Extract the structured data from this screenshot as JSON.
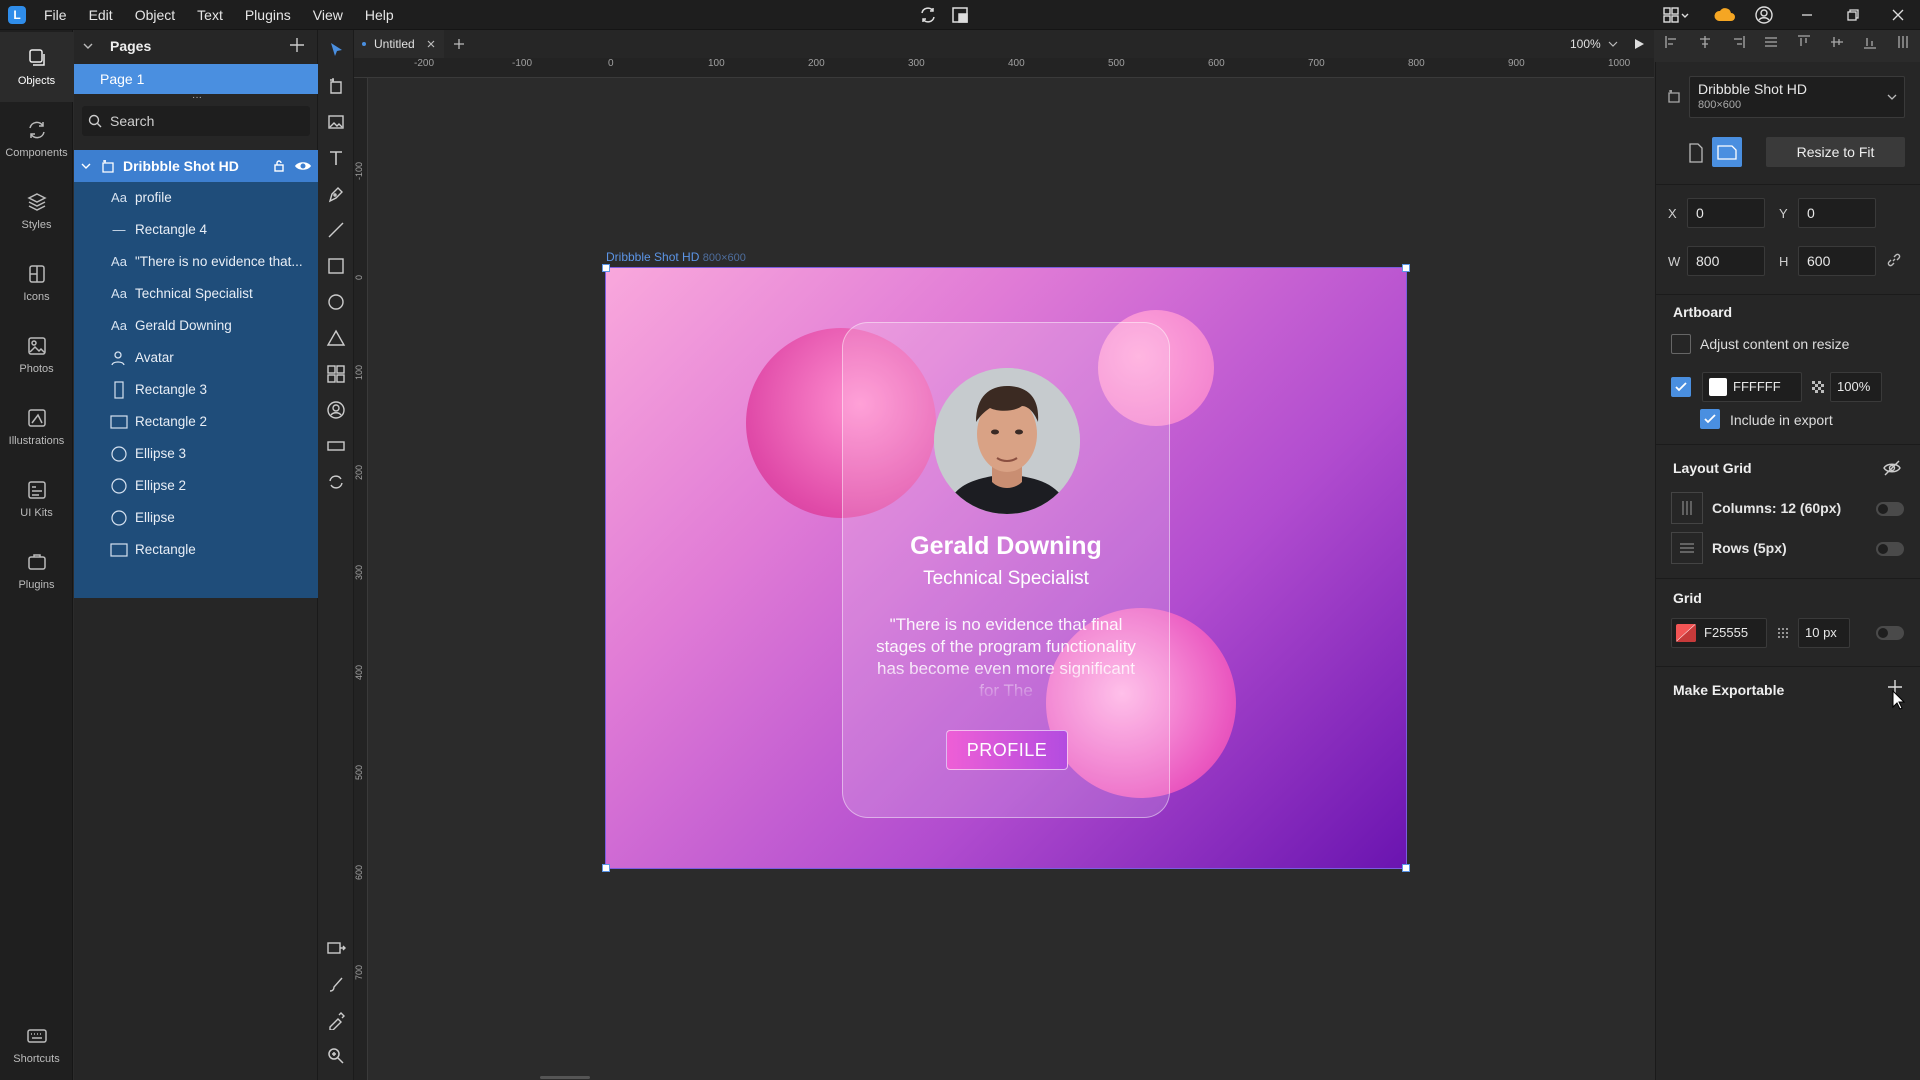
{
  "menu": [
    "File",
    "Edit",
    "Object",
    "Text",
    "Plugins",
    "View",
    "Help"
  ],
  "rail": [
    {
      "label": "Objects",
      "icon": "objects-icon"
    },
    {
      "label": "Components",
      "icon": "components-icon"
    },
    {
      "label": "Styles",
      "icon": "styles-icon"
    },
    {
      "label": "Icons",
      "icon": "icons-icon"
    },
    {
      "label": "Photos",
      "icon": "photos-icon"
    },
    {
      "label": "Illustrations",
      "icon": "illustrations-icon"
    },
    {
      "label": "UI Kits",
      "icon": "ui-kits-icon"
    },
    {
      "label": "Plugins",
      "icon": "plugins-icon"
    }
  ],
  "rail_bottom": "Shortcuts",
  "pages": {
    "title": "Pages",
    "current": "Page 1"
  },
  "search": {
    "placeholder": "Search"
  },
  "layers": {
    "root": "Dribbble Shot HD",
    "items": [
      {
        "icon": "Aa",
        "label": "profile"
      },
      {
        "icon": "—",
        "label": "Rectangle 4"
      },
      {
        "icon": "Aa",
        "label": "\"There is no evidence that..."
      },
      {
        "icon": "Aa",
        "label": "Technical Specialist"
      },
      {
        "icon": "Aa",
        "label": "Gerald Downing"
      },
      {
        "icon": "user",
        "label": "Avatar"
      },
      {
        "icon": "rect-tall",
        "label": "Rectangle 3"
      },
      {
        "icon": "rect",
        "label": "Rectangle 2"
      },
      {
        "icon": "circle",
        "label": "Ellipse 3"
      },
      {
        "icon": "circle",
        "label": "Ellipse 2"
      },
      {
        "icon": "circle",
        "label": "Ellipse"
      },
      {
        "icon": "rect",
        "label": "Rectangle"
      }
    ]
  },
  "tab": {
    "name": "Untitled"
  },
  "zoom": "100%",
  "ruler": {
    "top": [
      "-200",
      "-100",
      "0",
      "100",
      "200",
      "300",
      "400",
      "500",
      "600",
      "700",
      "800",
      "900",
      "1000"
    ],
    "left": [
      "-100",
      "0",
      "100",
      "200",
      "300",
      "400",
      "500",
      "600",
      "700"
    ]
  },
  "artboard": {
    "label": "Dribbble Shot HD",
    "size_label": "800×600",
    "card": {
      "name": "Gerald Downing",
      "role": "Technical Specialist",
      "quote": "\"There is no evidence that final stages of the program functionality has become even more significant for The",
      "button": "PROFILE"
    }
  },
  "props": {
    "preset": {
      "name": "Dribbble Shot HD",
      "size": "800×600"
    },
    "resize_button": "Resize to Fit",
    "x_label": "X",
    "x": "0",
    "y_label": "Y",
    "y": "0",
    "w_label": "W",
    "w": "800",
    "h_label": "H",
    "h": "600",
    "artboard_title": "Artboard",
    "adjust_content": "Adjust content on resize",
    "fill_hex": "FFFFFF",
    "fill_opacity": "100%",
    "include_export": "Include in export",
    "layout_grid_title": "Layout Grid",
    "columns": "Columns: 12 (60px)",
    "rows": "Rows (5px)",
    "grid_title": "Grid",
    "grid_color": "F25555",
    "grid_size": "10 px",
    "make_exportable": "Make Exportable"
  },
  "colors": {
    "accent": "#4a8fe0",
    "layer_selected": "#3d7fd0",
    "layer_group": "#1f4d7a",
    "grid_swatch": "#f25555"
  }
}
